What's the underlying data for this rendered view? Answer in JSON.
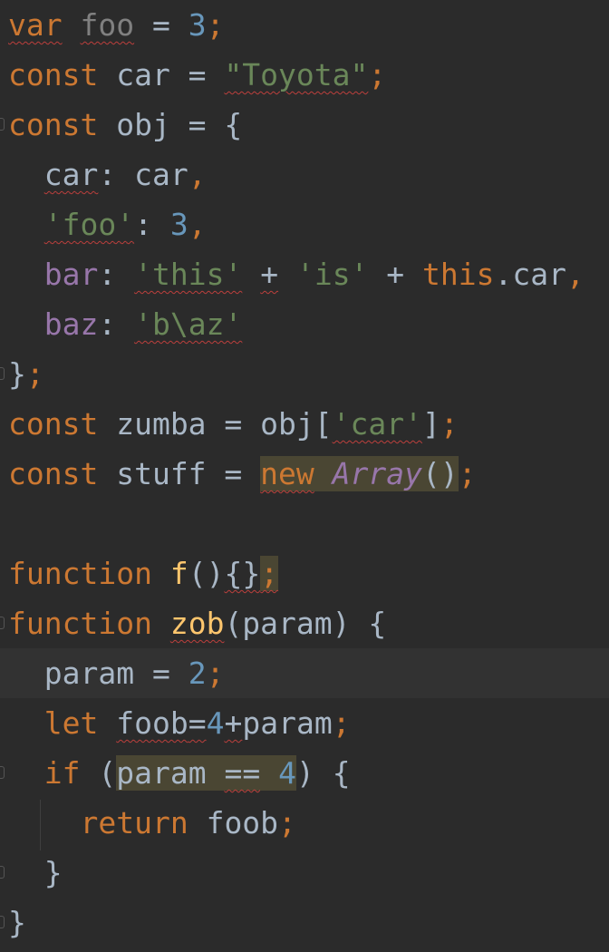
{
  "editor": {
    "lines": [
      {
        "tokens": [
          {
            "t": "var",
            "c": "kw",
            "w": 1
          },
          {
            "t": " ",
            "c": "plain"
          },
          {
            "t": "foo",
            "c": "unused",
            "w": 1
          },
          {
            "t": " = ",
            "c": "plain"
          },
          {
            "t": "3",
            "c": "num"
          },
          {
            "t": ";",
            "c": "kw"
          }
        ]
      },
      {
        "tokens": [
          {
            "t": "const",
            "c": "kw"
          },
          {
            "t": " car = ",
            "c": "plain"
          },
          {
            "t": "\"Toyota\"",
            "c": "str",
            "w": 1
          },
          {
            "t": ";",
            "c": "kw"
          }
        ]
      },
      {
        "fold": true,
        "tokens": [
          {
            "t": "const",
            "c": "kw"
          },
          {
            "t": " obj = {",
            "c": "plain"
          }
        ]
      },
      {
        "tokens": [
          {
            "t": "  ",
            "c": "plain"
          },
          {
            "t": "car",
            "c": "plain",
            "w": 1
          },
          {
            "t": ": car",
            "c": "plain"
          },
          {
            "t": ",",
            "c": "kw"
          }
        ]
      },
      {
        "tokens": [
          {
            "t": "  ",
            "c": "plain"
          },
          {
            "t": "'foo'",
            "c": "str",
            "w": 1
          },
          {
            "t": ": ",
            "c": "plain"
          },
          {
            "t": "3",
            "c": "num"
          },
          {
            "t": ",",
            "c": "kw"
          }
        ]
      },
      {
        "tokens": [
          {
            "t": "  ",
            "c": "plain"
          },
          {
            "t": "bar",
            "c": "prop"
          },
          {
            "t": ": ",
            "c": "plain"
          },
          {
            "t": "'this'",
            "c": "str",
            "w": 1
          },
          {
            "t": " ",
            "c": "plain"
          },
          {
            "t": "+",
            "c": "plain",
            "w": 1
          },
          {
            "t": " ",
            "c": "plain"
          },
          {
            "t": "'is'",
            "c": "str"
          },
          {
            "t": " + ",
            "c": "plain"
          },
          {
            "t": "this",
            "c": "kw"
          },
          {
            "t": ".car",
            "c": "plain"
          },
          {
            "t": ",",
            "c": "kw"
          }
        ]
      },
      {
        "tokens": [
          {
            "t": "  ",
            "c": "plain"
          },
          {
            "t": "baz",
            "c": "prop"
          },
          {
            "t": ": ",
            "c": "plain"
          },
          {
            "t": "'b\\az'",
            "c": "str",
            "w": 1
          }
        ]
      },
      {
        "fold": true,
        "tokens": [
          {
            "t": "}",
            "c": "plain"
          },
          {
            "t": ";",
            "c": "kw"
          }
        ]
      },
      {
        "tokens": [
          {
            "t": "const",
            "c": "kw"
          },
          {
            "t": " zumba = obj[",
            "c": "plain"
          },
          {
            "t": "'car'",
            "c": "str",
            "w": 1
          },
          {
            "t": "]",
            "c": "plain"
          },
          {
            "t": ";",
            "c": "kw"
          }
        ]
      },
      {
        "tokens": [
          {
            "t": "const",
            "c": "kw"
          },
          {
            "t": " stuff = ",
            "c": "plain"
          },
          {
            "t": "new",
            "c": "kw",
            "w": 1,
            "h": 1
          },
          {
            "t": " ",
            "c": "plain",
            "h": 1
          },
          {
            "t": "Array",
            "c": "cls",
            "h": 1
          },
          {
            "t": "()",
            "c": "plain",
            "h": 1
          },
          {
            "t": ";",
            "c": "kw"
          }
        ]
      },
      {
        "tokens": []
      },
      {
        "tokens": [
          {
            "t": "function",
            "c": "kw"
          },
          {
            "t": " ",
            "c": "plain"
          },
          {
            "t": "f",
            "c": "fn"
          },
          {
            "t": "()",
            "c": "plain"
          },
          {
            "t": "{}",
            "c": "plain",
            "w": 1
          },
          {
            "t": ";",
            "c": "kw",
            "w": 1,
            "h": 1
          }
        ]
      },
      {
        "fold": true,
        "tokens": [
          {
            "t": "function",
            "c": "kw"
          },
          {
            "t": " ",
            "c": "plain"
          },
          {
            "t": "zob",
            "c": "fn",
            "w": 1
          },
          {
            "t": "(param) {",
            "c": "plain"
          }
        ]
      },
      {
        "current": true,
        "tokens": [
          {
            "t": "  param = ",
            "c": "plain"
          },
          {
            "t": "2",
            "c": "num"
          },
          {
            "t": ";",
            "c": "kw"
          }
        ]
      },
      {
        "tokens": [
          {
            "t": "  ",
            "c": "plain"
          },
          {
            "t": "let",
            "c": "kw"
          },
          {
            "t": " ",
            "c": "plain"
          },
          {
            "t": "foob",
            "c": "plain",
            "w": 1
          },
          {
            "t": "=",
            "c": "plain",
            "w": 1
          },
          {
            "t": "4",
            "c": "num"
          },
          {
            "t": "+",
            "c": "plain",
            "w": 1
          },
          {
            "t": "param",
            "c": "plain"
          },
          {
            "t": ";",
            "c": "kw"
          }
        ]
      },
      {
        "fold": true,
        "tokens": [
          {
            "t": "  ",
            "c": "plain"
          },
          {
            "t": "if",
            "c": "kw"
          },
          {
            "t": " (",
            "c": "plain"
          },
          {
            "t": "param ",
            "c": "plain",
            "h": 1
          },
          {
            "t": "==",
            "c": "plain",
            "w": 1,
            "h": 1
          },
          {
            "t": " ",
            "c": "plain",
            "h": 1
          },
          {
            "t": "4",
            "c": "num",
            "h": 1
          },
          {
            "t": ") {",
            "c": "plain"
          }
        ]
      },
      {
        "tokens": [
          {
            "t": "    ",
            "c": "plain"
          },
          {
            "t": "return",
            "c": "kw"
          },
          {
            "t": " foob",
            "c": "plain"
          },
          {
            "t": ";",
            "c": "kw"
          }
        ]
      },
      {
        "fold": true,
        "tokens": [
          {
            "t": "  }",
            "c": "plain"
          }
        ]
      },
      {
        "fold": true,
        "tokens": [
          {
            "t": "}",
            "c": "plain"
          }
        ]
      }
    ]
  }
}
